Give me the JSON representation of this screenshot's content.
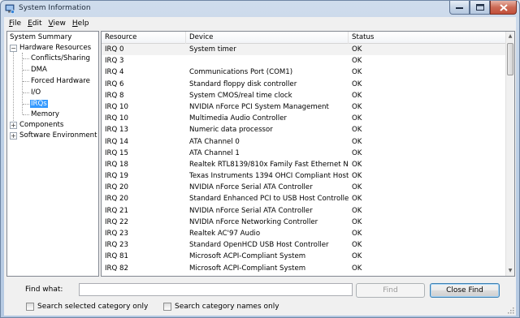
{
  "window": {
    "title": "System Information",
    "accent": "#3399ff"
  },
  "menu": [
    {
      "label": "File",
      "accelerator": "F"
    },
    {
      "label": "Edit",
      "accelerator": "E"
    },
    {
      "label": "View",
      "accelerator": "V"
    },
    {
      "label": "Help",
      "accelerator": "H"
    }
  ],
  "tree": {
    "system_summary": "System Summary",
    "hardware_resources": "Hardware Resources",
    "conflicts_sharing": "Conflicts/Sharing",
    "dma": "DMA",
    "forced_hardware": "Forced Hardware",
    "io": "I/O",
    "irqs": "IRQs",
    "memory": "Memory",
    "components": "Components",
    "software_environment": "Software Environment",
    "expanded_glyph": "−",
    "collapsed_glyph": "+"
  },
  "table": {
    "headers": [
      "Resource",
      "Device",
      "Status"
    ],
    "rows": [
      [
        "IRQ 0",
        "System timer",
        "OK"
      ],
      [
        "IRQ 3",
        "",
        "OK"
      ],
      [
        "IRQ 4",
        "Communications Port (COM1)",
        "OK"
      ],
      [
        "IRQ 6",
        "Standard floppy disk controller",
        "OK"
      ],
      [
        "IRQ 8",
        "System CMOS/real time clock",
        "OK"
      ],
      [
        "IRQ 10",
        "NVIDIA nForce PCI System Management",
        "OK"
      ],
      [
        "IRQ 10",
        "Multimedia Audio Controller",
        "OK"
      ],
      [
        "IRQ 13",
        "Numeric data processor",
        "OK"
      ],
      [
        "IRQ 14",
        "ATA Channel 0",
        "OK"
      ],
      [
        "IRQ 15",
        "ATA Channel 1",
        "OK"
      ],
      [
        "IRQ 18",
        "Realtek RTL8139/810x Family Fast Ethernet NIC",
        "OK"
      ],
      [
        "IRQ 19",
        "Texas Instruments 1394 OHCI Compliant Host C...",
        "OK"
      ],
      [
        "IRQ 20",
        "NVIDIA nForce Serial ATA Controller",
        "OK"
      ],
      [
        "IRQ 20",
        "Standard Enhanced PCI to USB Host Controller",
        "OK"
      ],
      [
        "IRQ 21",
        "NVIDIA nForce Serial ATA Controller",
        "OK"
      ],
      [
        "IRQ 22",
        "NVIDIA nForce Networking Controller",
        "OK"
      ],
      [
        "IRQ 23",
        "Realtek AC'97 Audio",
        "OK"
      ],
      [
        "IRQ 23",
        "Standard OpenHCD USB Host Controller",
        "OK"
      ],
      [
        "IRQ 81",
        "Microsoft ACPI-Compliant System",
        "OK"
      ],
      [
        "IRQ 82",
        "Microsoft ACPI-Compliant System",
        "OK"
      ],
      [
        "IRQ 83",
        "Microsoft ACPI-Compliant System",
        "OK"
      ]
    ]
  },
  "find": {
    "label": "Find what:",
    "value": "",
    "find_button": "Find",
    "close_button": "Close Find",
    "search_selected": "Search selected category only",
    "search_names": "Search category names only"
  },
  "icons": {
    "app": "system-information-icon",
    "minimize": "minimize-icon",
    "maximize": "maximize-icon",
    "close": "close-icon"
  }
}
